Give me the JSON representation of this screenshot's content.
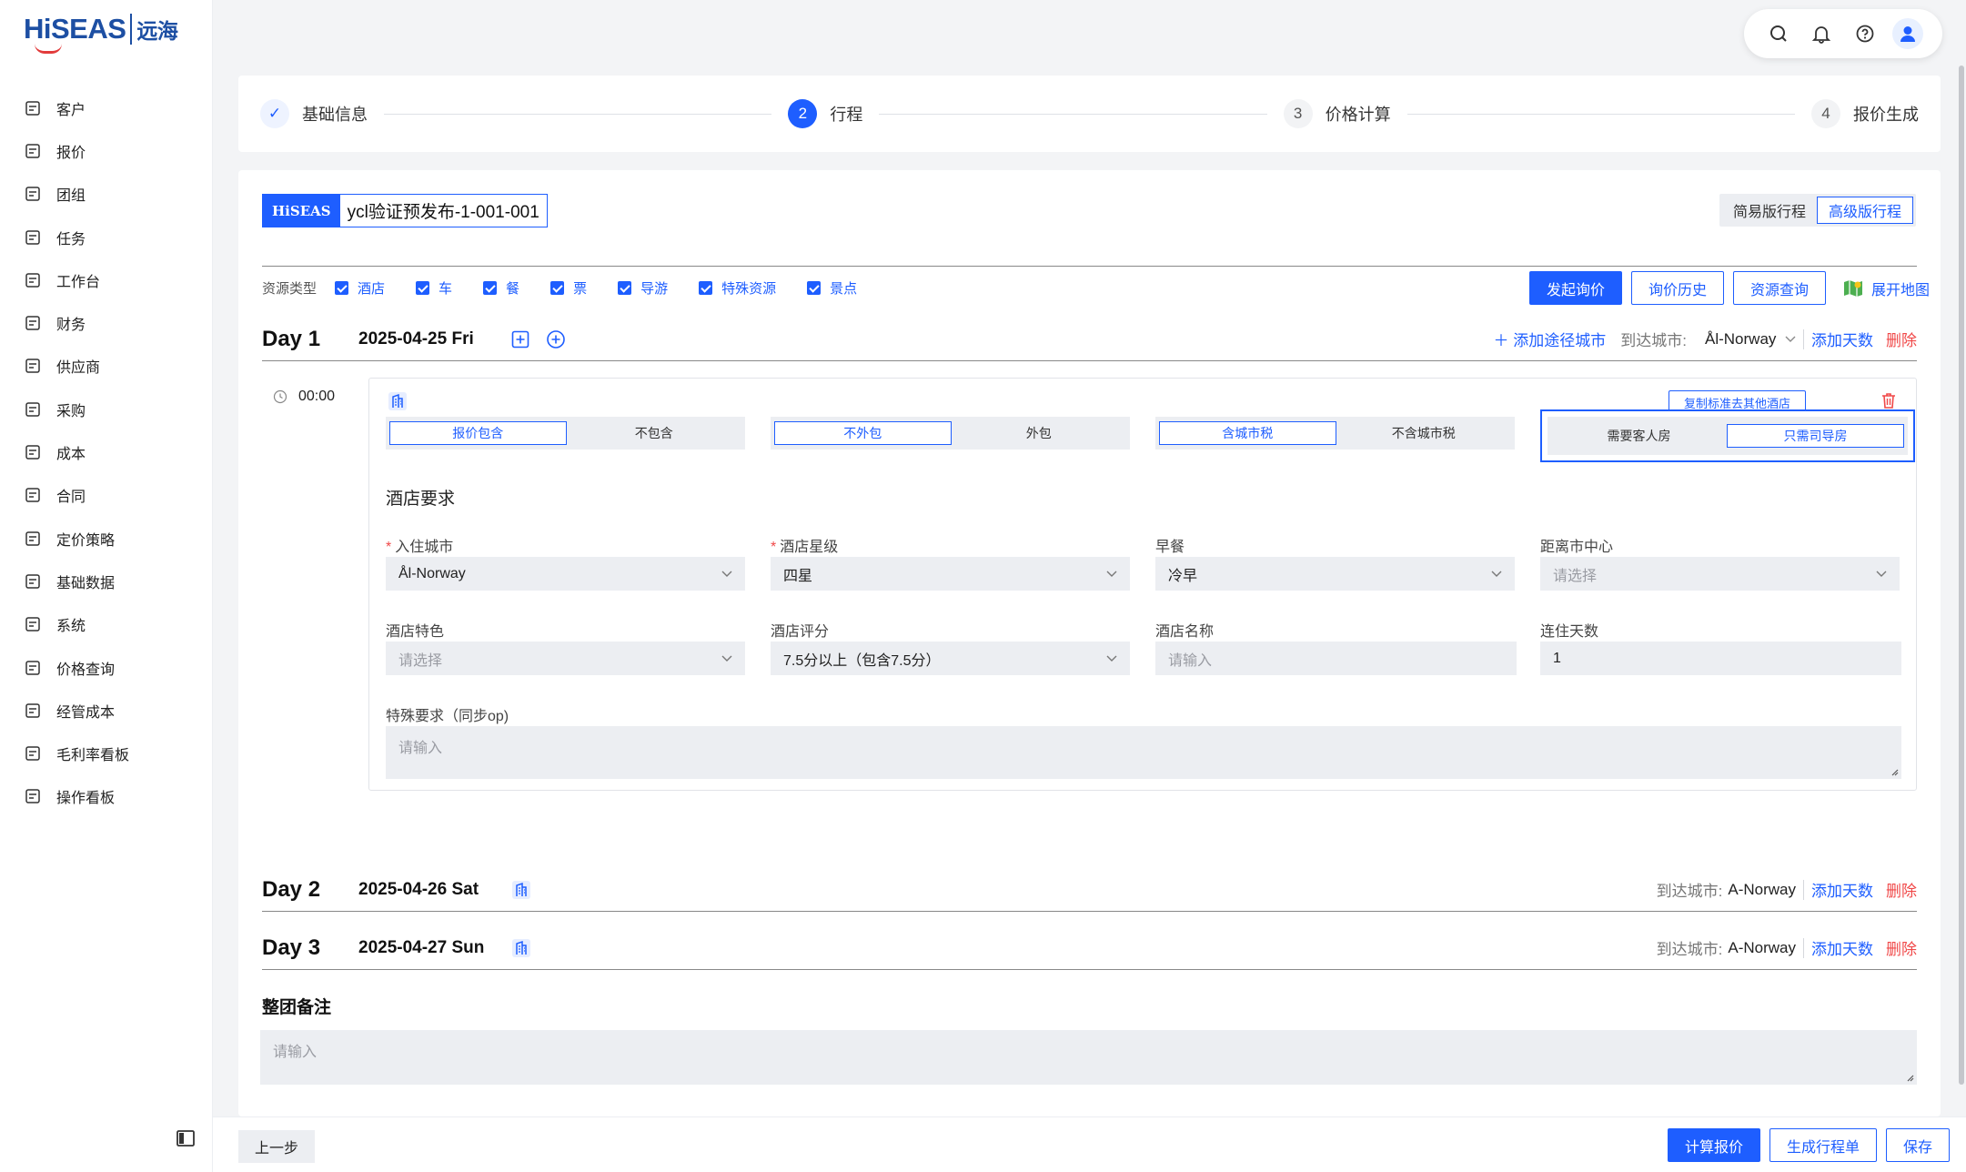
{
  "app": {
    "logo_text": "HiSEAS",
    "logo_cn": "远海"
  },
  "sidebar": {
    "items": [
      {
        "label": "客户",
        "icon": "customer-icon"
      },
      {
        "label": "报价",
        "icon": "quote-icon"
      },
      {
        "label": "团组",
        "icon": "group-icon"
      },
      {
        "label": "任务",
        "icon": "task-icon"
      },
      {
        "label": "工作台",
        "icon": "workbench-icon"
      },
      {
        "label": "财务",
        "icon": "finance-icon"
      },
      {
        "label": "供应商",
        "icon": "supplier-icon"
      },
      {
        "label": "采购",
        "icon": "purchase-icon"
      },
      {
        "label": "成本",
        "icon": "cost-icon"
      },
      {
        "label": "合同",
        "icon": "contract-icon"
      },
      {
        "label": "定价策略",
        "icon": "pricing-strategy-icon"
      },
      {
        "label": "基础数据",
        "icon": "base-data-icon"
      },
      {
        "label": "系统",
        "icon": "system-icon"
      },
      {
        "label": "价格查询",
        "icon": "price-query-icon"
      },
      {
        "label": "经管成本",
        "icon": "management-cost-icon"
      },
      {
        "label": "毛利率看板",
        "icon": "margin-board-icon"
      },
      {
        "label": "操作看板",
        "icon": "operation-board-icon"
      }
    ]
  },
  "steps": [
    {
      "num": "✓",
      "label": "基础信息",
      "state": "done"
    },
    {
      "num": "2",
      "label": "行程",
      "state": "active"
    },
    {
      "num": "3",
      "label": "价格计算",
      "state": "todo"
    },
    {
      "num": "4",
      "label": "报价生成",
      "state": "todo"
    }
  ],
  "header": {
    "brand_tag": "HiSEAS",
    "code": "ycl验证预发布-1-001-001",
    "mode_simple": "简易版行程",
    "mode_advanced": "高级版行程"
  },
  "resource_types": {
    "label": "资源类型",
    "items": [
      "酒店",
      "车",
      "餐",
      "票",
      "导游",
      "特殊资源",
      "景点"
    ]
  },
  "actions": {
    "inquiry": "发起询价",
    "history": "询价历史",
    "query": "资源查询",
    "map": "展开地图"
  },
  "days": [
    {
      "title": "Day 1",
      "date": "2025-04-25 Fri",
      "add_city": "添加途径城市",
      "arrive_label": "到达城市:",
      "city": "Ål-Norway",
      "add_day": "添加天数",
      "delete": "删除"
    },
    {
      "title": "Day 2",
      "date": "2025-04-26 Sat",
      "arrive_label": "到达城市:",
      "city": "A-Norway",
      "add_day": "添加天数",
      "delete": "删除"
    },
    {
      "title": "Day 3",
      "date": "2025-04-27 Sun",
      "arrive_label": "到达城市:",
      "city": "A-Norway",
      "add_day": "添加天数",
      "delete": "删除"
    }
  ],
  "hotel": {
    "time": "00:00",
    "copy_btn": "复制标准去其他酒店",
    "toggles": [
      {
        "a": "报价包含",
        "b": "不包含",
        "selected": "a"
      },
      {
        "a": "不外包",
        "b": "外包",
        "selected": "a"
      },
      {
        "a": "含城市税",
        "b": "不含城市税",
        "selected": "a"
      },
      {
        "a": "需要客人房",
        "b": "只需司导房",
        "selected": "b"
      }
    ],
    "section_title": "酒店要求",
    "fields": {
      "city": {
        "label": "入住城市",
        "value": "Ål-Norway"
      },
      "star": {
        "label": "酒店星级",
        "value": "四星"
      },
      "breakfast": {
        "label": "早餐",
        "value": "冷早"
      },
      "distance": {
        "label": "距离市中心",
        "placeholder": "请选择"
      },
      "feature": {
        "label": "酒店特色",
        "placeholder": "请选择"
      },
      "rating": {
        "label": "酒店评分",
        "value": "7.5分以上（包含7.5分）"
      },
      "name": {
        "label": "酒店名称",
        "placeholder": "请输入"
      },
      "nights": {
        "label": "连住天数",
        "value": "1"
      },
      "special": {
        "label": "特殊要求（同步op)",
        "placeholder": "请输入"
      }
    }
  },
  "remark": {
    "title": "整团备注",
    "placeholder": "请输入"
  },
  "footer": {
    "prev": "上一步",
    "calc": "计算报价",
    "itinerary": "生成行程单",
    "save": "保存"
  },
  "colors": {
    "primary": "#1e5eff",
    "danger": "#f04848",
    "field_bg": "#eceef2"
  }
}
